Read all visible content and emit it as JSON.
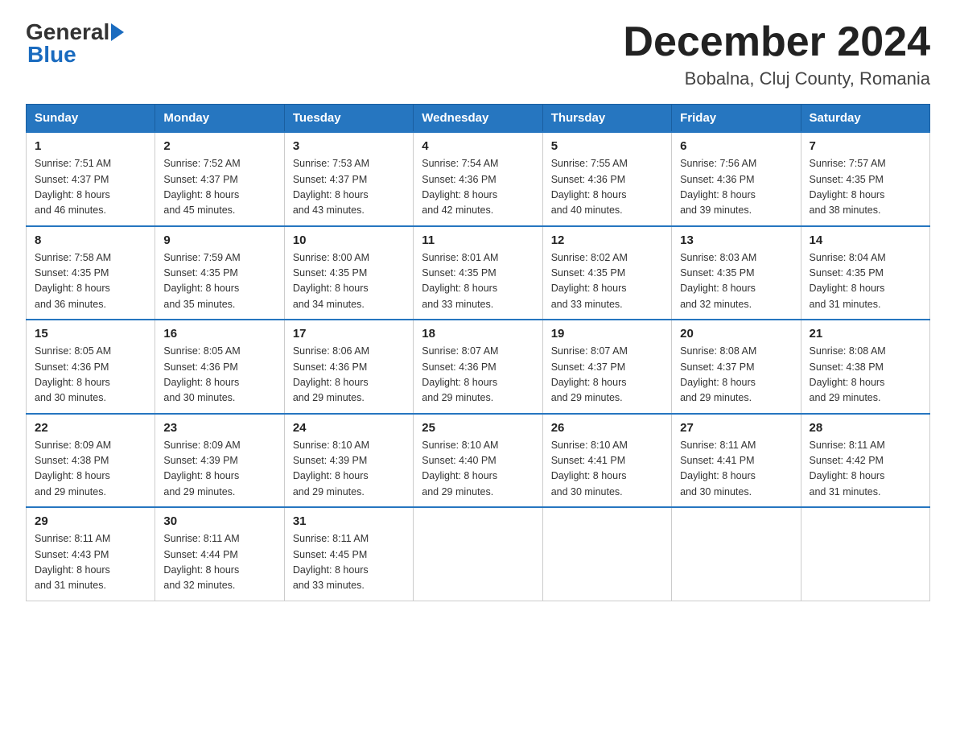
{
  "logo": {
    "general": "General",
    "blue": "Blue"
  },
  "title": {
    "month_year": "December 2024",
    "location": "Bobalna, Cluj County, Romania"
  },
  "weekdays": [
    "Sunday",
    "Monday",
    "Tuesday",
    "Wednesday",
    "Thursday",
    "Friday",
    "Saturday"
  ],
  "weeks": [
    [
      {
        "day": "1",
        "sunrise": "7:51 AM",
        "sunset": "4:37 PM",
        "daylight": "8 hours and 46 minutes."
      },
      {
        "day": "2",
        "sunrise": "7:52 AM",
        "sunset": "4:37 PM",
        "daylight": "8 hours and 45 minutes."
      },
      {
        "day": "3",
        "sunrise": "7:53 AM",
        "sunset": "4:37 PM",
        "daylight": "8 hours and 43 minutes."
      },
      {
        "day": "4",
        "sunrise": "7:54 AM",
        "sunset": "4:36 PM",
        "daylight": "8 hours and 42 minutes."
      },
      {
        "day": "5",
        "sunrise": "7:55 AM",
        "sunset": "4:36 PM",
        "daylight": "8 hours and 40 minutes."
      },
      {
        "day": "6",
        "sunrise": "7:56 AM",
        "sunset": "4:36 PM",
        "daylight": "8 hours and 39 minutes."
      },
      {
        "day": "7",
        "sunrise": "7:57 AM",
        "sunset": "4:35 PM",
        "daylight": "8 hours and 38 minutes."
      }
    ],
    [
      {
        "day": "8",
        "sunrise": "7:58 AM",
        "sunset": "4:35 PM",
        "daylight": "8 hours and 36 minutes."
      },
      {
        "day": "9",
        "sunrise": "7:59 AM",
        "sunset": "4:35 PM",
        "daylight": "8 hours and 35 minutes."
      },
      {
        "day": "10",
        "sunrise": "8:00 AM",
        "sunset": "4:35 PM",
        "daylight": "8 hours and 34 minutes."
      },
      {
        "day": "11",
        "sunrise": "8:01 AM",
        "sunset": "4:35 PM",
        "daylight": "8 hours and 33 minutes."
      },
      {
        "day": "12",
        "sunrise": "8:02 AM",
        "sunset": "4:35 PM",
        "daylight": "8 hours and 33 minutes."
      },
      {
        "day": "13",
        "sunrise": "8:03 AM",
        "sunset": "4:35 PM",
        "daylight": "8 hours and 32 minutes."
      },
      {
        "day": "14",
        "sunrise": "8:04 AM",
        "sunset": "4:35 PM",
        "daylight": "8 hours and 31 minutes."
      }
    ],
    [
      {
        "day": "15",
        "sunrise": "8:05 AM",
        "sunset": "4:36 PM",
        "daylight": "8 hours and 30 minutes."
      },
      {
        "day": "16",
        "sunrise": "8:05 AM",
        "sunset": "4:36 PM",
        "daylight": "8 hours and 30 minutes."
      },
      {
        "day": "17",
        "sunrise": "8:06 AM",
        "sunset": "4:36 PM",
        "daylight": "8 hours and 29 minutes."
      },
      {
        "day": "18",
        "sunrise": "8:07 AM",
        "sunset": "4:36 PM",
        "daylight": "8 hours and 29 minutes."
      },
      {
        "day": "19",
        "sunrise": "8:07 AM",
        "sunset": "4:37 PM",
        "daylight": "8 hours and 29 minutes."
      },
      {
        "day": "20",
        "sunrise": "8:08 AM",
        "sunset": "4:37 PM",
        "daylight": "8 hours and 29 minutes."
      },
      {
        "day": "21",
        "sunrise": "8:08 AM",
        "sunset": "4:38 PM",
        "daylight": "8 hours and 29 minutes."
      }
    ],
    [
      {
        "day": "22",
        "sunrise": "8:09 AM",
        "sunset": "4:38 PM",
        "daylight": "8 hours and 29 minutes."
      },
      {
        "day": "23",
        "sunrise": "8:09 AM",
        "sunset": "4:39 PM",
        "daylight": "8 hours and 29 minutes."
      },
      {
        "day": "24",
        "sunrise": "8:10 AM",
        "sunset": "4:39 PM",
        "daylight": "8 hours and 29 minutes."
      },
      {
        "day": "25",
        "sunrise": "8:10 AM",
        "sunset": "4:40 PM",
        "daylight": "8 hours and 29 minutes."
      },
      {
        "day": "26",
        "sunrise": "8:10 AM",
        "sunset": "4:41 PM",
        "daylight": "8 hours and 30 minutes."
      },
      {
        "day": "27",
        "sunrise": "8:11 AM",
        "sunset": "4:41 PM",
        "daylight": "8 hours and 30 minutes."
      },
      {
        "day": "28",
        "sunrise": "8:11 AM",
        "sunset": "4:42 PM",
        "daylight": "8 hours and 31 minutes."
      }
    ],
    [
      {
        "day": "29",
        "sunrise": "8:11 AM",
        "sunset": "4:43 PM",
        "daylight": "8 hours and 31 minutes."
      },
      {
        "day": "30",
        "sunrise": "8:11 AM",
        "sunset": "4:44 PM",
        "daylight": "8 hours and 32 minutes."
      },
      {
        "day": "31",
        "sunrise": "8:11 AM",
        "sunset": "4:45 PM",
        "daylight": "8 hours and 33 minutes."
      },
      null,
      null,
      null,
      null
    ]
  ],
  "labels": {
    "sunrise": "Sunrise:",
    "sunset": "Sunset:",
    "daylight": "Daylight:"
  }
}
